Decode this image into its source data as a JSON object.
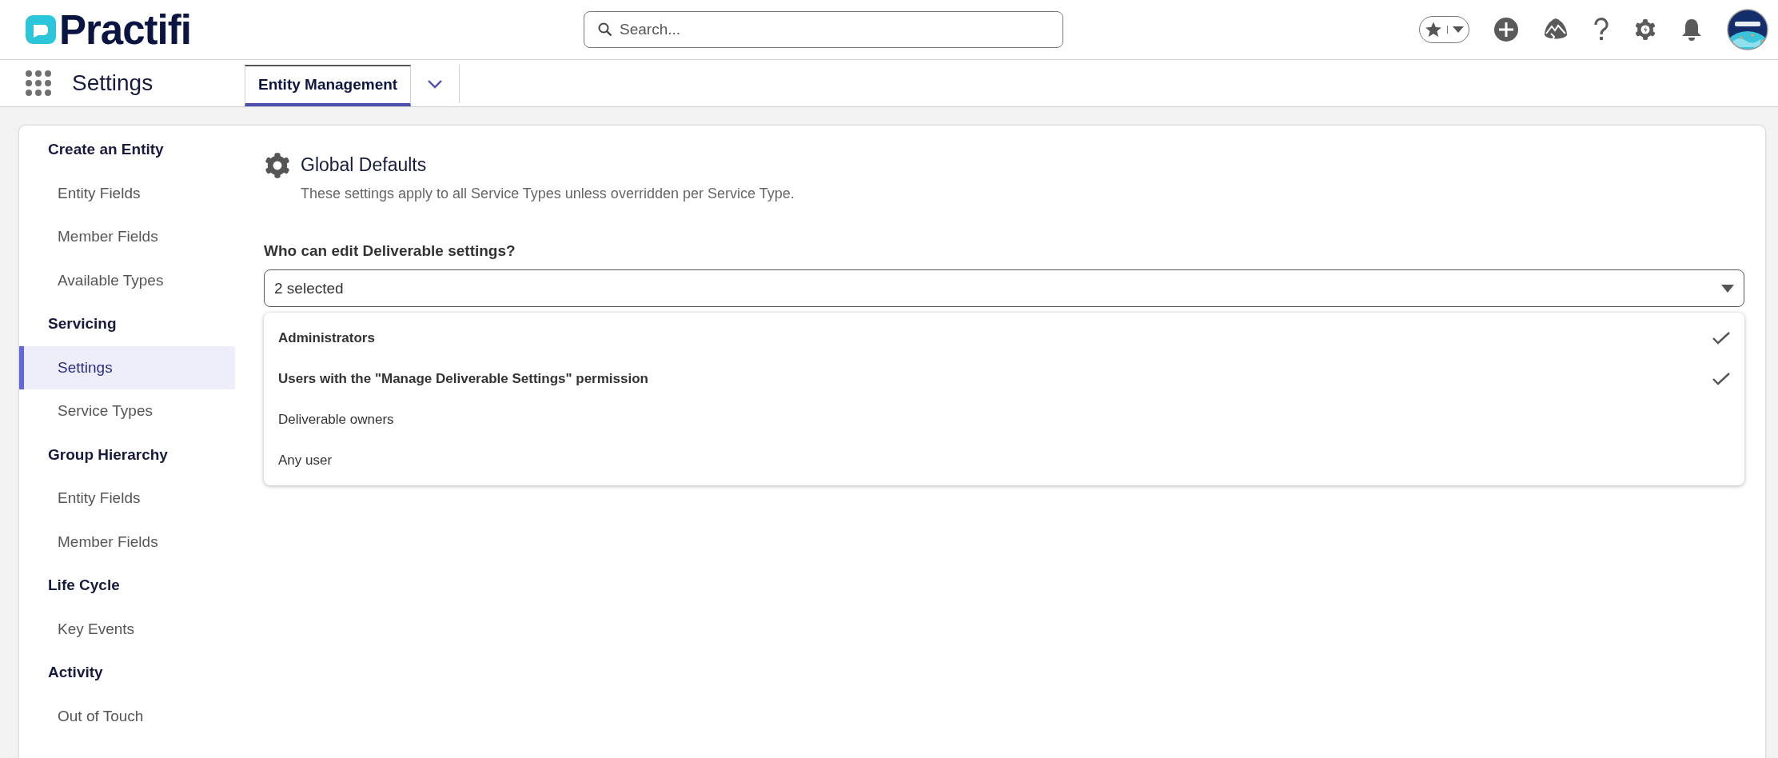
{
  "header": {
    "logo": "Practifi",
    "search": {
      "placeholder": "Search..."
    }
  },
  "nav": {
    "app_name": "Settings",
    "tabs": [
      {
        "label": "Entity Management",
        "selected": true
      }
    ]
  },
  "sidebar": {
    "sections": [
      {
        "title": "Create an Entity",
        "items": [
          {
            "label": "Entity Fields",
            "selected": false
          },
          {
            "label": "Member Fields",
            "selected": false
          },
          {
            "label": "Available Types",
            "selected": false
          }
        ]
      },
      {
        "title": "Servicing",
        "items": [
          {
            "label": "Settings",
            "selected": true
          },
          {
            "label": "Service Types",
            "selected": false
          }
        ]
      },
      {
        "title": "Group Hierarchy",
        "items": [
          {
            "label": "Entity Fields",
            "selected": false
          },
          {
            "label": "Member Fields",
            "selected": false
          }
        ]
      },
      {
        "title": "Life Cycle",
        "items": [
          {
            "label": "Key Events",
            "selected": false
          }
        ]
      },
      {
        "title": "Activity",
        "items": [
          {
            "label": "Out of Touch",
            "selected": false
          }
        ]
      }
    ]
  },
  "content": {
    "title": "Global Defaults",
    "subtitle": "These settings apply to all Service Types unless overridden per Service Type.",
    "field": {
      "label": "Who can edit Deliverable settings?",
      "value": "2 selected",
      "expanded": true,
      "options": [
        {
          "label": "Administrators",
          "selected": true
        },
        {
          "label": "Users with the \"Manage Deliverable Settings\" permission",
          "selected": true
        },
        {
          "label": "Deliverable owners",
          "selected": false
        },
        {
          "label": "Any user",
          "selected": false
        }
      ]
    }
  }
}
